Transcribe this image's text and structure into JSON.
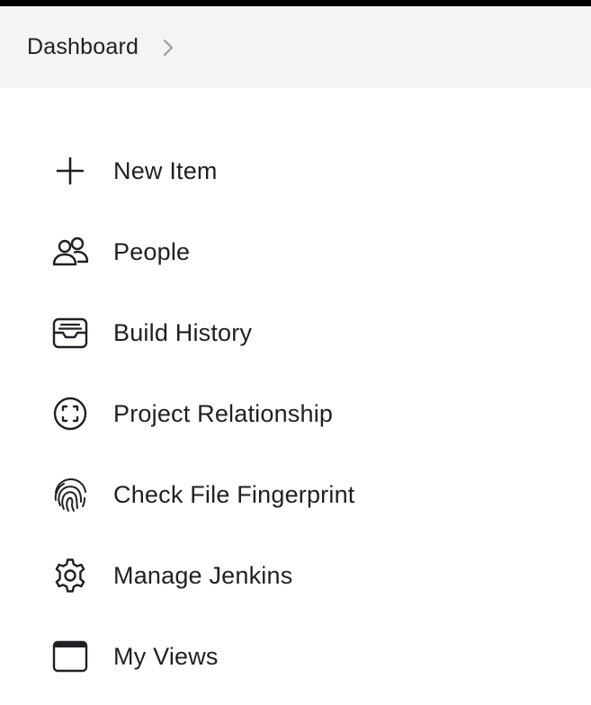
{
  "breadcrumb": {
    "items": [
      {
        "label": "Dashboard"
      }
    ]
  },
  "tasks": [
    {
      "label": "New Item",
      "icon": "plus-icon"
    },
    {
      "label": "People",
      "icon": "people-icon"
    },
    {
      "label": "Build History",
      "icon": "inbox-tray-icon"
    },
    {
      "label": "Project Relationship",
      "icon": "scan-circle-icon"
    },
    {
      "label": "Check File Fingerprint",
      "icon": "fingerprint-icon"
    },
    {
      "label": "Manage Jenkins",
      "icon": "gear-icon"
    },
    {
      "label": "My Views",
      "icon": "browser-window-icon"
    }
  ],
  "colors": {
    "text": "#1f1f24",
    "breadcrumb_bg": "#f4f4f6",
    "top_strip": "#000000",
    "separator": "#9b9ba3"
  }
}
